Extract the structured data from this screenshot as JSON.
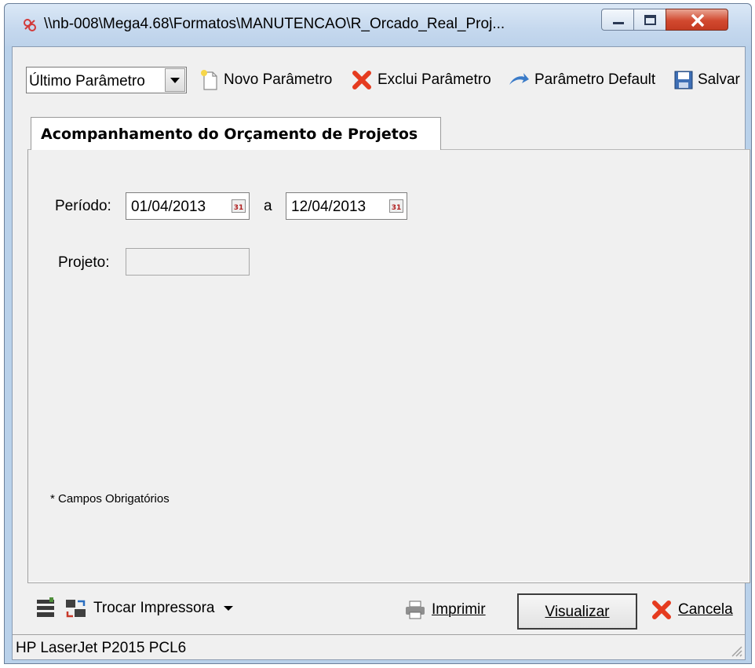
{
  "window": {
    "title": "\\\\nb-008\\Mega4.68\\Formatos\\MANUTENCAO\\R_Orcado_Real_Proj...",
    "icon": "mega-app-icon",
    "controls": [
      "minimize-icon",
      "maximize-icon",
      "close-icon"
    ]
  },
  "toolbar": {
    "param_select_value": "Último Parâmetro",
    "new_param_label": "Novo Parâmetro",
    "delete_param_label": "Exclui Parâmetro",
    "default_param_label": "Parâmetro Default",
    "save_label": "Salvar"
  },
  "tab": {
    "title": "Acompanhamento do Orçamento de Projetos"
  },
  "form": {
    "period_label": "Período:",
    "date_from": "01/04/2013",
    "date_separator": "a",
    "date_to": "12/04/2013",
    "project_label": "Projeto:",
    "project_value": "",
    "required_note": "* Campos Obrigatórios"
  },
  "bottom": {
    "change_printer_label": "Trocar Impressora",
    "print_label": "Imprimir",
    "preview_label": "Visualizar",
    "cancel_label": "Cancela"
  },
  "status": {
    "printer_name": "HP LaserJet P2015 PCL6"
  },
  "colors": {
    "title_bar": "#c5d8ee",
    "close_button": "#d2492f",
    "client_bg": "#f0f0f0",
    "delete_red": "#e53b1f"
  }
}
